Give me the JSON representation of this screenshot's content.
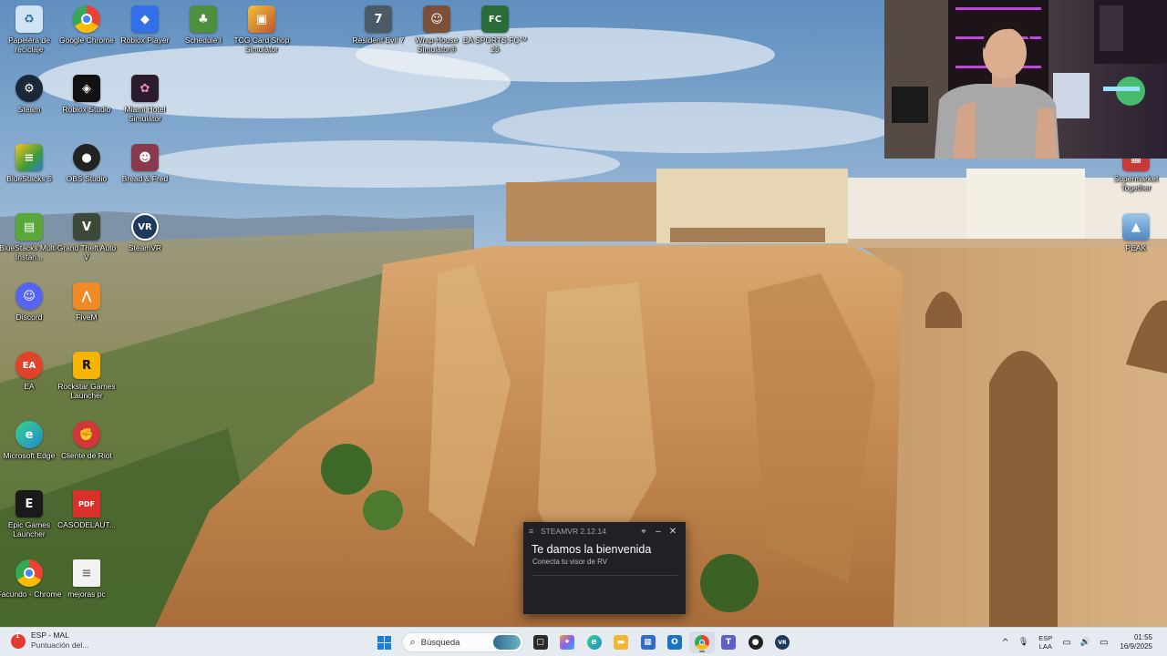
{
  "desktop": {
    "icons": [
      {
        "label": "Papelera de reciclaje",
        "icon": "recycle-bin-icon",
        "glyph": "♻",
        "color": "#cfe3f3"
      },
      {
        "label": "Google Chrome",
        "icon": "chrome-icon",
        "glyph": "",
        "color": "#ea4335"
      },
      {
        "label": "Roblox Player",
        "icon": "roblox-player-icon",
        "glyph": "◆",
        "color": "#3370e8"
      },
      {
        "label": "Schedule I",
        "icon": "schedule-i-icon",
        "glyph": "♣",
        "color": "#4d8f3c"
      },
      {
        "label": "TCG Card Shop Simulator",
        "icon": "tcg-card-shop-icon",
        "glyph": "▣",
        "color": "#c0542e"
      },
      {
        "label": "Resident Evil 7",
        "icon": "resident-evil-7-icon",
        "glyph": "7",
        "color": "#4a5a66"
      },
      {
        "label": "Wrap House Simulator®",
        "icon": "wrap-house-simulator-icon",
        "glyph": "☺",
        "color": "#7a5138"
      },
      {
        "label": "EA SPORTS FC™ 25",
        "icon": "ea-sports-fc-icon",
        "glyph": "FC",
        "color": "#2a6b3a"
      },
      {
        "label": "Steam",
        "icon": "steam-icon",
        "glyph": "⚙",
        "color": "#1b2838"
      },
      {
        "label": "Roblox Studio",
        "icon": "roblox-studio-icon",
        "glyph": "◈",
        "color": "#111111"
      },
      {
        "label": "Miami Hotel Simulator",
        "icon": "miami-hotel-simulator-icon",
        "glyph": "✿",
        "color": "#2a1c2c"
      },
      {
        "label": "BlueStacks 5",
        "icon": "bluestacks-icon",
        "glyph": "≡",
        "color": "#3c9a3c"
      },
      {
        "label": "OBS Studio",
        "icon": "obs-studio-icon",
        "glyph": "●",
        "color": "#222222"
      },
      {
        "label": "Bread & Fred",
        "icon": "bread-and-fred-icon",
        "glyph": "☻",
        "color": "#8a3a4e"
      },
      {
        "label": "BlueStacks Multi-Instan...",
        "icon": "bluestacks-multi-instance-icon",
        "glyph": "▤",
        "color": "#58a83a"
      },
      {
        "label": "Grand Theft Auto V",
        "icon": "gta-v-icon",
        "glyph": "V",
        "color": "#3d4a3a"
      },
      {
        "label": "SteamVR",
        "icon": "steamvr-icon",
        "glyph": "VR",
        "color": "#1d3a5c"
      },
      {
        "label": "Discord",
        "icon": "discord-icon",
        "glyph": "☺",
        "color": "#5865f2"
      },
      {
        "label": "FiveM",
        "icon": "fivem-icon",
        "glyph": "⋀",
        "color": "#f08a24"
      },
      {
        "label": "EA",
        "icon": "ea-icon",
        "glyph": "EA",
        "color": "#e0432a"
      },
      {
        "label": "Rockstar Games Launcher",
        "icon": "rockstar-launcher-icon",
        "glyph": "R",
        "color": "#f4b400"
      },
      {
        "label": "Microsoft Edge",
        "icon": "edge-icon",
        "glyph": "e",
        "color": "#1f8ad2"
      },
      {
        "label": "Cliente de Riot",
        "icon": "riot-client-icon",
        "glyph": "✊",
        "color": "#d13639"
      },
      {
        "label": "Epic Games Launcher",
        "icon": "epic-games-icon",
        "glyph": "E",
        "color": "#1a1a1a"
      },
      {
        "label": "CASODELAUT...",
        "icon": "pdf-file-icon",
        "glyph": "PDF",
        "color": "#d9302c"
      },
      {
        "label": "Facundo - Chrome",
        "icon": "chrome-profile-icon",
        "glyph": "",
        "color": "#ea4335"
      },
      {
        "label": "mejoras pc",
        "icon": "text-file-icon",
        "glyph": "≡",
        "color": "#f2f2f2"
      },
      {
        "label": "Supermarket Together",
        "icon": "supermarket-together-icon",
        "glyph": "▦",
        "color": "#c73a3a"
      },
      {
        "label": "PEAK",
        "icon": "peak-icon",
        "glyph": "▲",
        "color": "#6fa8dc"
      }
    ]
  },
  "steamvr": {
    "title": "STEAMVR 2.12.14",
    "heading": "Te damos la bienvenida",
    "subtitle": "Conecta tu visor de RV",
    "pin_glyph": "⌖",
    "minimize_glyph": "–",
    "close_glyph": "✕"
  },
  "taskbar": {
    "weather_line1": "ESP - MAL",
    "weather_line2": "Puntuación del...",
    "weather_badge": "1",
    "search_placeholder": "Búsqueda",
    "apps": [
      {
        "icon": "task-view-icon",
        "glyph": "▢",
        "color": "#2b2b2b"
      },
      {
        "icon": "copilot-icon",
        "glyph": "✦",
        "color": "#8a5cf0"
      },
      {
        "icon": "edge-taskbar-icon",
        "glyph": "e",
        "color": "#1f8ad2"
      },
      {
        "icon": "file-explorer-icon",
        "glyph": "▬",
        "color": "#f2b632"
      },
      {
        "icon": "microsoft-store-icon",
        "glyph": "▦",
        "color": "#2f6ec8"
      },
      {
        "icon": "outlook-icon",
        "glyph": "O",
        "color": "#1a73c8"
      },
      {
        "icon": "chrome-taskbar-icon",
        "glyph": "●",
        "color": "#ea4335"
      },
      {
        "icon": "teams-icon",
        "glyph": "T",
        "color": "#5b5fc7"
      },
      {
        "icon": "obs-taskbar-icon",
        "glyph": "●",
        "color": "#222222"
      },
      {
        "icon": "steamvr-taskbar-icon",
        "glyph": "VR",
        "color": "#1d3a5c"
      }
    ],
    "tray": {
      "chevron": "^",
      "mic": "🎙",
      "lang_line1": "ESP",
      "lang_line2": "LAA",
      "network": "▭",
      "volume": "🔊",
      "battery": "▭",
      "time": "01:55",
      "date": "16/9/2025"
    }
  }
}
